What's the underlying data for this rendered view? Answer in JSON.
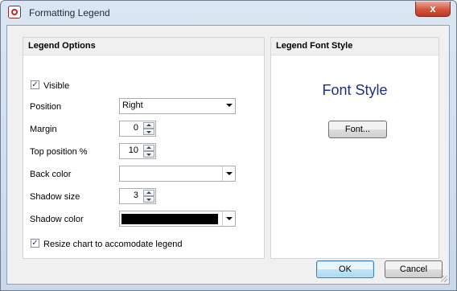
{
  "window": {
    "title": "Formatting Legend",
    "close_label": "x"
  },
  "legend_options": {
    "header": "Legend Options",
    "visible": {
      "label": "Visible",
      "checked": true
    },
    "position": {
      "label": "Position",
      "value": "Right"
    },
    "margin": {
      "label": "Margin",
      "value": "0"
    },
    "top_position": {
      "label": "Top position %",
      "value": "10"
    },
    "back_color": {
      "label": "Back color",
      "value": ""
    },
    "shadow_size": {
      "label": "Shadow size",
      "value": "3"
    },
    "shadow_color": {
      "label": "Shadow color",
      "color": "#000000"
    },
    "resize_chart": {
      "label": "Resize chart to accomodate legend",
      "checked": true
    }
  },
  "legend_font_style": {
    "header": "Legend Font Style",
    "preview": "Font Style",
    "font_button": "Font..."
  },
  "footer": {
    "ok": "OK",
    "cancel": "Cancel"
  },
  "colors": {
    "preview_text": "#1c2f8c",
    "close_button": "#c2371f",
    "title_bar": "#c9d8ea"
  },
  "checkmark": "✓"
}
